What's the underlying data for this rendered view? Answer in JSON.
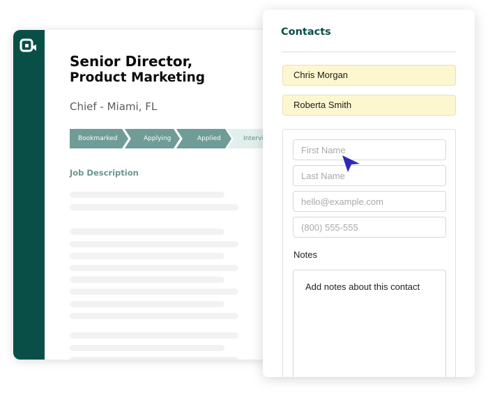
{
  "job": {
    "title_line1": "Senior Director,",
    "title_line2": "Product Marketing",
    "subtitle": "Chief - Miami, FL",
    "stages": [
      {
        "label": "Bookmarked",
        "state": "done"
      },
      {
        "label": "Applying",
        "state": "done"
      },
      {
        "label": "Applied",
        "state": "done"
      },
      {
        "label": "Interviewing",
        "state": "pending"
      }
    ],
    "section_heading": "Job Description"
  },
  "contacts": {
    "title": "Contacts",
    "saved": [
      "Chris Morgan",
      "Roberta Smith"
    ],
    "form": {
      "first_name_placeholder": "First Name",
      "last_name_placeholder": "Last Name",
      "email_placeholder": "hello@example.com",
      "phone_placeholder": "(800) 555-555",
      "notes_label": "Notes",
      "notes_placeholder": "Add notes about this contact"
    }
  },
  "colors": {
    "brand": "#0a4f47",
    "stage_done": "#6f9c96",
    "stage_pending": "#e3efed",
    "chip": "#fdf7cf",
    "cursor": "#2d2ab8"
  },
  "icons": [
    "app-logo-icon",
    "mouse-cursor-icon"
  ]
}
